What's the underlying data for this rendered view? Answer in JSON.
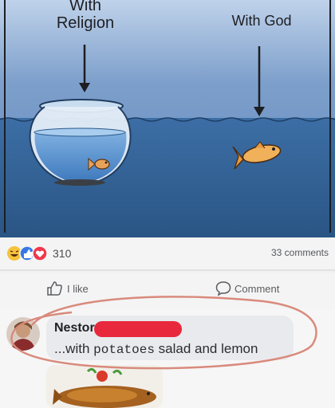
{
  "image": {
    "caption_left_line1": "With",
    "caption_left_line2": "Religion",
    "caption_right": "With God"
  },
  "reactions": {
    "icons": [
      "laugh-reaction-icon",
      "like-reaction-icon",
      "love-reaction-icon"
    ],
    "count": "310"
  },
  "comments_count": "33 comments",
  "actions": {
    "like_label": "I like",
    "comment_label": "Comment"
  },
  "comment": {
    "author": "Nestor",
    "text_prefix": "...with ",
    "text_mono": "potatoes",
    "text_suffix": " salad and lemon"
  },
  "colors": {
    "water": "#2f5f93",
    "sky": "#5f86ba",
    "redaction": "#e8283c",
    "circle": "#d98a7c"
  }
}
